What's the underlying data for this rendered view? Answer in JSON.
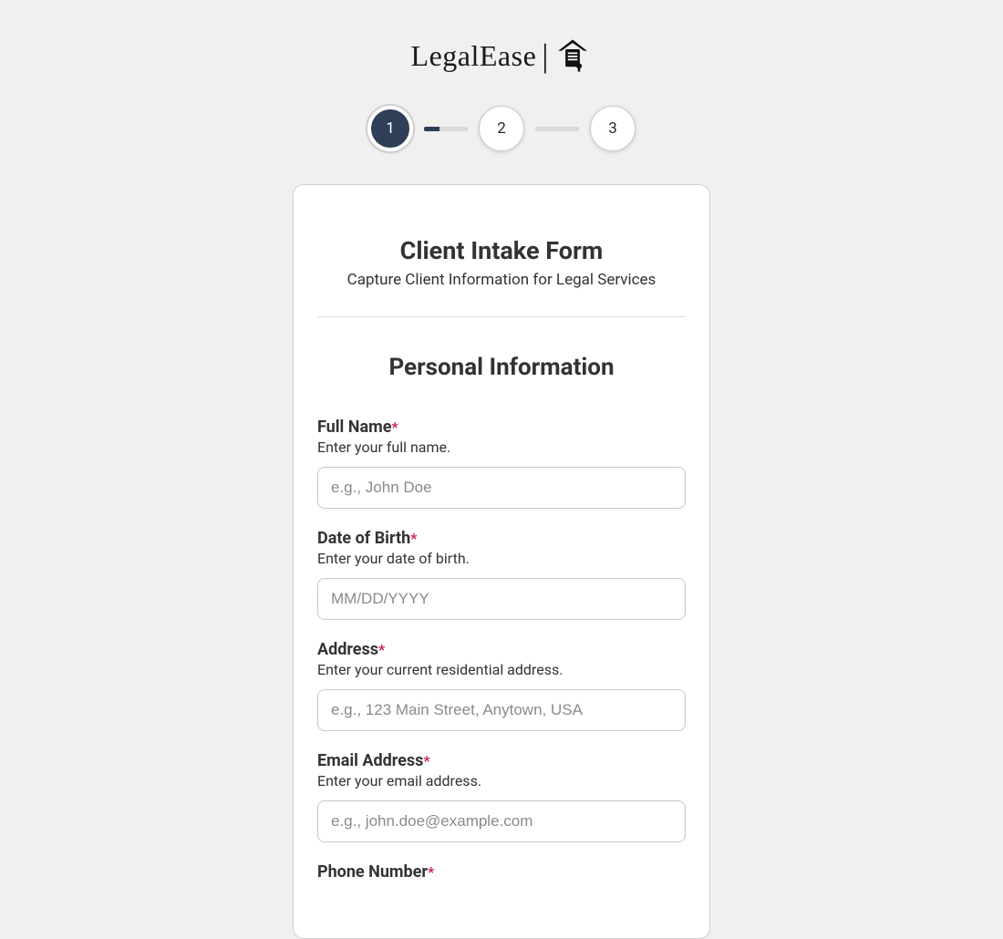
{
  "brand": {
    "name": "LegalEase"
  },
  "stepper": {
    "steps": [
      "1",
      "2",
      "3"
    ],
    "active_index": 0,
    "connector1_fill_pct": 35,
    "connector2_fill_pct": 0
  },
  "card": {
    "title": "Client Intake Form",
    "subtitle": "Capture Client Information for Legal Services",
    "section_title": "Personal Information"
  },
  "fields": {
    "full_name": {
      "label": "Full Name",
      "required": "*",
      "desc": "Enter your full name.",
      "placeholder": "e.g., John Doe"
    },
    "dob": {
      "label": "Date of Birth",
      "required": "*",
      "desc": "Enter your date of birth.",
      "placeholder": "MM/DD/YYYY"
    },
    "address": {
      "label": "Address",
      "required": "*",
      "desc": "Enter your current residential address.",
      "placeholder": "e.g., 123 Main Street, Anytown, USA"
    },
    "email": {
      "label": "Email Address",
      "required": "*",
      "desc": "Enter your email address.",
      "placeholder": "e.g., john.doe@example.com"
    },
    "phone": {
      "label": "Phone Number",
      "required": "*"
    }
  }
}
